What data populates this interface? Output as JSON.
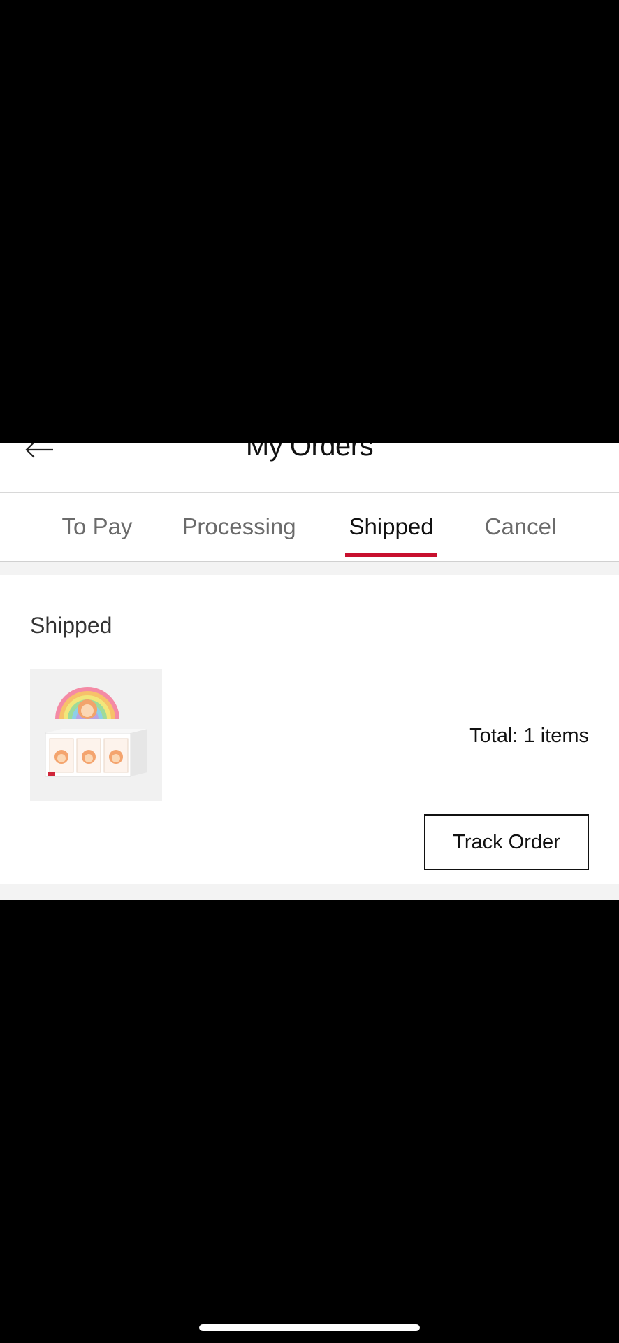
{
  "header": {
    "title": "My Orders",
    "back_icon": "arrow-left-icon"
  },
  "tabs": [
    {
      "label": "To Pay",
      "active": false
    },
    {
      "label": "Processing",
      "active": false
    },
    {
      "label": "Shipped",
      "active": true
    },
    {
      "label": "Cancel",
      "active": false
    }
  ],
  "order": {
    "status": "Shipped",
    "total": "Total: 1 items",
    "track_label": "Track Order",
    "thumbnail": "product-box-thumbnail"
  },
  "colors": {
    "accent": "#c8102e",
    "background": "#000000",
    "panel": "#ffffff",
    "separator": "#f3f3f3"
  }
}
